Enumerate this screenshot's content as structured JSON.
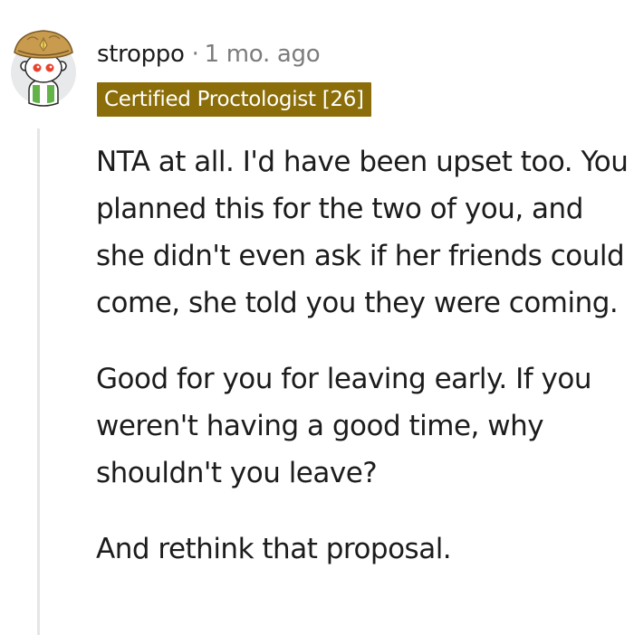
{
  "comment": {
    "author": "stroppo",
    "separator": "·",
    "timestamp": "1 mo. ago",
    "flair": {
      "text": "Certified Proctologist [26]",
      "background": "#8b6e09",
      "color": "#ffffff"
    },
    "avatar_icon": "snoo-avatar-with-hat-icon",
    "paragraphs": [
      "NTA at all. I'd have been upset too. You planned this for the two of you, and she didn't even ask if her friends could come, she told you they were coming.",
      "Good for you for leaving early. If you weren't having a good time, why shouldn't you leave?",
      "And rethink that proposal."
    ]
  },
  "colors": {
    "text": "#1c1c1c",
    "meta": "#7c7c7c",
    "thread_line": "#e6e6e6"
  }
}
